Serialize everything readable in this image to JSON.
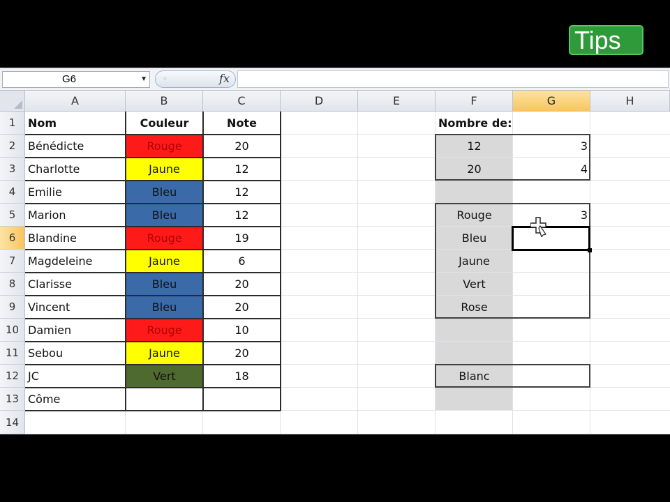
{
  "badge": {
    "label": "Tips"
  },
  "formula_bar": {
    "name_box": "G6",
    "fx": "fx",
    "formula": ""
  },
  "columns": [
    "A",
    "B",
    "C",
    "D",
    "E",
    "F",
    "G",
    "H"
  ],
  "selected_column": "G",
  "rows": [
    "1",
    "2",
    "3",
    "4",
    "5",
    "6",
    "7",
    "8",
    "9",
    "10",
    "11",
    "12",
    "13",
    "14"
  ],
  "selected_row": "6",
  "table": {
    "headers": {
      "nom": "Nom",
      "couleur": "Couleur",
      "note": "Note"
    },
    "records": [
      {
        "nom": "Bénédicte",
        "couleur": "Rouge",
        "note": "20"
      },
      {
        "nom": "Charlotte",
        "couleur": "Jaune",
        "note": "12"
      },
      {
        "nom": "Emilie",
        "couleur": "Bleu",
        "note": "12"
      },
      {
        "nom": "Marion",
        "couleur": "Bleu",
        "note": "12"
      },
      {
        "nom": "Blandine",
        "couleur": "Rouge",
        "note": "19"
      },
      {
        "nom": "Magdeleine",
        "couleur": "Jaune",
        "note": "6"
      },
      {
        "nom": "Clarisse",
        "couleur": "Bleu",
        "note": "20"
      },
      {
        "nom": "Vincent",
        "couleur": "Bleu",
        "note": "20"
      },
      {
        "nom": "Damien",
        "couleur": "Rouge",
        "note": "10"
      },
      {
        "nom": "Sebou",
        "couleur": "Jaune",
        "note": "20"
      },
      {
        "nom": "JC",
        "couleur": "Vert",
        "note": "18"
      },
      {
        "nom": "Côme",
        "couleur": "",
        "note": ""
      }
    ]
  },
  "color_fills": {
    "Rouge": "#ff1a1a",
    "Jaune": "#ffff00",
    "Bleu": "#3a6aa8",
    "Vert": "#4f6a2e"
  },
  "summary": {
    "title": "Nombre de:",
    "notes": [
      {
        "label": "12",
        "count": "3"
      },
      {
        "label": "20",
        "count": "4"
      }
    ],
    "colors": [
      {
        "label": "Rouge",
        "count": "3"
      },
      {
        "label": "Bleu",
        "count": ""
      },
      {
        "label": "Jaune",
        "count": ""
      },
      {
        "label": "Vert",
        "count": ""
      },
      {
        "label": "Rose",
        "count": ""
      }
    ],
    "extra": "Blanc"
  },
  "column_f_fill": "#d9d9d9"
}
